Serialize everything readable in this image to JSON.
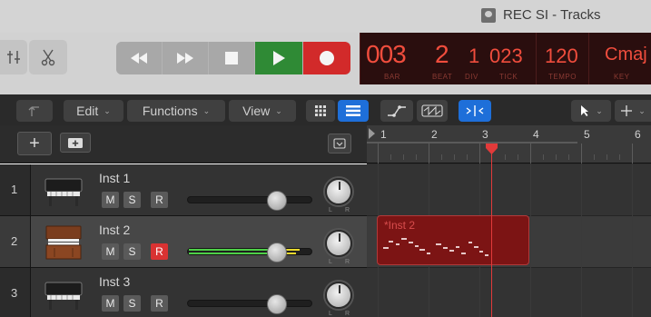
{
  "window": {
    "title": "REC SI - Tracks"
  },
  "lcd": {
    "bar": "003",
    "beat": "2",
    "div": "1",
    "tick": "023",
    "tempo": "120",
    "key": "Cmaj",
    "labels": {
      "bar": "BAR",
      "beat": "BEAT",
      "div": "DIV",
      "tick": "TICK",
      "tempo": "TEMPO",
      "key": "KEY"
    }
  },
  "toolbar": {
    "edit": "Edit",
    "functions": "Functions",
    "view": "View"
  },
  "ruler": {
    "bars": [
      "1",
      "2",
      "3",
      "4",
      "5",
      "6"
    ]
  },
  "tracks": [
    {
      "number": "1",
      "name": "Inst 1",
      "mute": "M",
      "solo": "S",
      "record": "R",
      "record_armed": false,
      "pan_left": "L",
      "pan_right": "R"
    },
    {
      "number": "2",
      "name": "Inst 2",
      "mute": "M",
      "solo": "S",
      "record": "R",
      "record_armed": true,
      "pan_left": "L",
      "pan_right": "R"
    },
    {
      "number": "3",
      "name": "Inst 3",
      "mute": "M",
      "solo": "S",
      "record": "R",
      "record_armed": false,
      "pan_left": "L",
      "pan_right": "R"
    }
  ],
  "region": {
    "name": "*Inst 2"
  },
  "colors": {
    "play": "#2f8a35",
    "record": "#d22a2a",
    "lcd_text": "#f04d3d",
    "region": "#7c1414",
    "playhead": "#e23a3a",
    "selected_tool": "#1e6fd9"
  }
}
